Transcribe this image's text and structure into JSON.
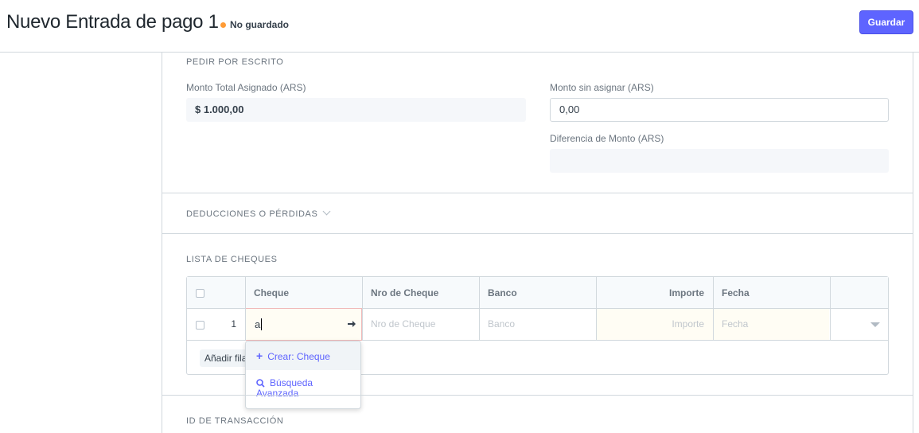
{
  "header": {
    "title": "Nuevo Entrada de pago 1",
    "status": "No guardado",
    "save_label": "Guardar",
    "status_color": "#ff9b35",
    "primary_color": "#5e64ff"
  },
  "pedir_section": {
    "label": "PEDIR POR ESCRITO",
    "total_label": "Monto Total Asignado (ARS)",
    "total_value": "$ 1.000,00",
    "unallocated_label": "Monto sin asignar (ARS)",
    "unallocated_value": "0,00",
    "difference_label": "Diferencia de Monto (ARS)",
    "difference_value": ""
  },
  "deductions_section": {
    "label": "DEDUCCIONES O PÉRDIDAS"
  },
  "cheques_section": {
    "label": "LISTA DE CHEQUES",
    "columns": [
      "Cheque",
      "Nro de Cheque",
      "Banco",
      "Importe",
      "Fecha"
    ],
    "row": {
      "index": "1",
      "cheque_value": "a",
      "nro_placeholder": "Nro de Cheque",
      "banco_placeholder": "Banco",
      "importe_placeholder": "Importe",
      "fecha_placeholder": "Fecha"
    },
    "add_row_label": "Añadir fila"
  },
  "autocomplete": {
    "create_label": "Crear: Cheque",
    "search_label_line1": "Búsqueda",
    "search_label_line2": "Avanzada"
  },
  "transaction_section": {
    "label": "ID DE TRANSACCIÓN"
  }
}
